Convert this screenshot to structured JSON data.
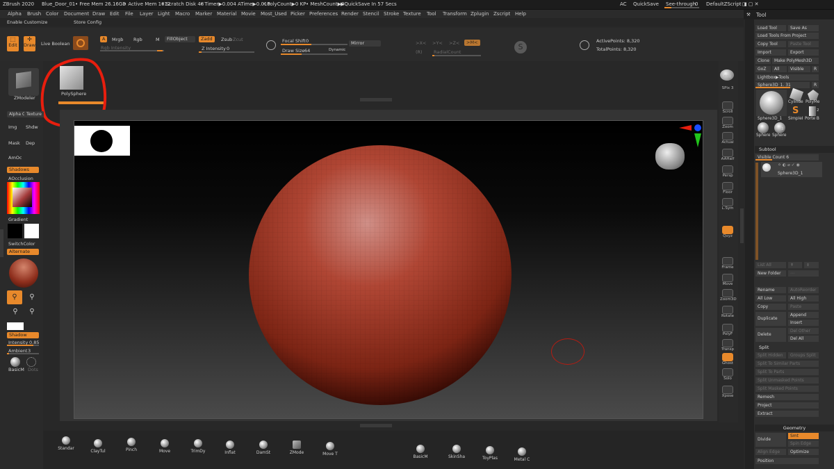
{
  "titlebar": {
    "app": "ZBrush 2020",
    "doc": "Blue_Door_01",
    "free_mem": "• Free Mem 26.16GB",
    "active_mem": "• Active Mem 1012",
    "scratch": "• Scratch Disk 48",
    "timer": "• Timer▶0.004 ATime▶0.016",
    "polycount": "• PolyCount▶0 KP",
    "meshcount": "• MeshCount▶0",
    "quicksave_in": "▶QuickSave In 57 Secs",
    "ac": "AC",
    "quicksave": "QuickSave",
    "see_through": "See-through",
    "see_through_val": "0",
    "zscript": "DefaultZScript"
  },
  "menu": [
    "Alpha",
    "Brush",
    "Color",
    "Document",
    "Draw",
    "Edit",
    "File",
    "Layer",
    "Light",
    "Macro",
    "Marker",
    "Material",
    "Movie",
    "Most_Used",
    "Picker",
    "Preferences",
    "Render",
    "Stencil",
    "Stroke",
    "Texture",
    "Tool",
    "Transform",
    "Zplugin",
    "Zscript",
    "Help"
  ],
  "subbar": {
    "customize": "Enable Customize",
    "store": "Store Config"
  },
  "shelf": {
    "edit": "Edit",
    "draw": "Draw",
    "live_boolean": "Live Boolean",
    "a": "A",
    "mrgb": "Mrgb",
    "rgb": "Rgb",
    "m": "M",
    "fill_object": "FillObject",
    "rgb_intensity": "Rgb Intensity",
    "zadd": "Zadd",
    "zsub": "Zsub",
    "zcut": "Zcut",
    "z_intensity": "Z Intensity",
    "z_intensity_val": "0",
    "focal_shift": "Focal Shift",
    "focal_shift_val": "0",
    "draw_size": "Draw Size",
    "draw_size_val": "64",
    "dynamic": "Dynamic",
    "mirror": "Mirror",
    "px": ">X<",
    "py": ">Y<",
    "pz": ">Z<",
    "pm": ">M<",
    "r": "(R)",
    "radial_count": "RadialCount",
    "active_points": "ActivePoints: 8,320",
    "total_points": "TotalPoints: 8,320"
  },
  "left": {
    "zmodeler": "ZModeler",
    "polysphere": "PolySphere",
    "alpha": "Alpha O",
    "texture": "Texture",
    "img": "Img",
    "shdw": "Shdw",
    "mask": "Mask",
    "dep": "Dep",
    "amoc": "AmOc",
    "shadows": "Shadows",
    "aocclusion": "AOcclusion",
    "gradient": "Gradient",
    "switchcolor": "SwitchColor",
    "alternate": "Alternate",
    "shadow": "Shadow",
    "intensity": "Intensity",
    "intensity_val": "0.85",
    "ambient": "Ambient",
    "ambient_val": "3",
    "basicm": "BasicM",
    "dots": "Dots"
  },
  "rightstrip": [
    "BPR",
    "SPix 3",
    "Scroll",
    "Zoom",
    "Actual",
    "AAHalf",
    "Persp",
    "Floor",
    "L.Sym",
    "Qxyz",
    "Frame",
    "Move",
    "Zoom3D",
    "Rotate",
    "PolyF",
    "Transp",
    "Ghost",
    "Solo",
    "Xpose"
  ],
  "toolpanel": {
    "title": "Tool",
    "load_tool": "Load Tool",
    "save_as": "Save As",
    "load_from_project": "Load Tools From Project",
    "copy_tool": "Copy Tool",
    "paste_tool": "Paste Tool",
    "import": "Import",
    "export": "Export",
    "clone": "Clone",
    "make_polymesh": "Make PolyMesh3D",
    "goz": "GoZ",
    "all": "All",
    "visible": "Visible",
    "r": "R",
    "lightbox": "Lightbox▶Tools",
    "sphere_name": "Sphere3D_1.",
    "sphere_val": "31",
    "thumbs": [
      "Sphere3D_1",
      "Cylinde",
      "PolyMe",
      "SimpleI",
      "Porte B",
      "Sphere",
      "Sphere"
    ],
    "thumb_nums": [
      "2",
      "3"
    ],
    "subtool": "Subtool",
    "visible_count": "Visible Count",
    "visible_count_val": "6",
    "subtool_item": "Sphere3D_1",
    "list_all": "List All",
    "new_folder": "New Folder",
    "rename": "Rename",
    "autoreorder": "AutoReorder",
    "all_low": "All Low",
    "all_high": "All High",
    "copy": "Copy",
    "paste": "Paste",
    "duplicate": "Duplicate",
    "append": "Append",
    "insert": "Insert",
    "delete": "Delete",
    "del_other": "Del Other",
    "del_all": "Del All",
    "split": "Split",
    "split_hidden": "Split Hidden",
    "groups_split": "Groups Split",
    "split_similar": "Split To Similar Parts",
    "split_parts": "Split To Parts",
    "split_unmasked": "Split Unmasked Points",
    "split_masked": "Split Masked Points",
    "remesh": "Remesh",
    "project": "Project",
    "extract": "Extract",
    "geometry": "Geometry",
    "divide": "Divide",
    "smt": "Smt",
    "spin_edge": "Spin Edge",
    "align_edge": "Align Edge",
    "optimize": "Optimize",
    "position": "Position"
  },
  "brushes": [
    "Standar",
    "ClayTul",
    "Pinch",
    "Move",
    "TrimDy",
    "Inflat",
    "DamSt",
    "ZMode",
    "Move T",
    "BasicM",
    "SkinSha",
    "ToyPlas",
    "Metal C"
  ],
  "colors": {
    "accent": "#e8892b",
    "sphere": "#b04634",
    "highlight": "#e81e0e"
  }
}
